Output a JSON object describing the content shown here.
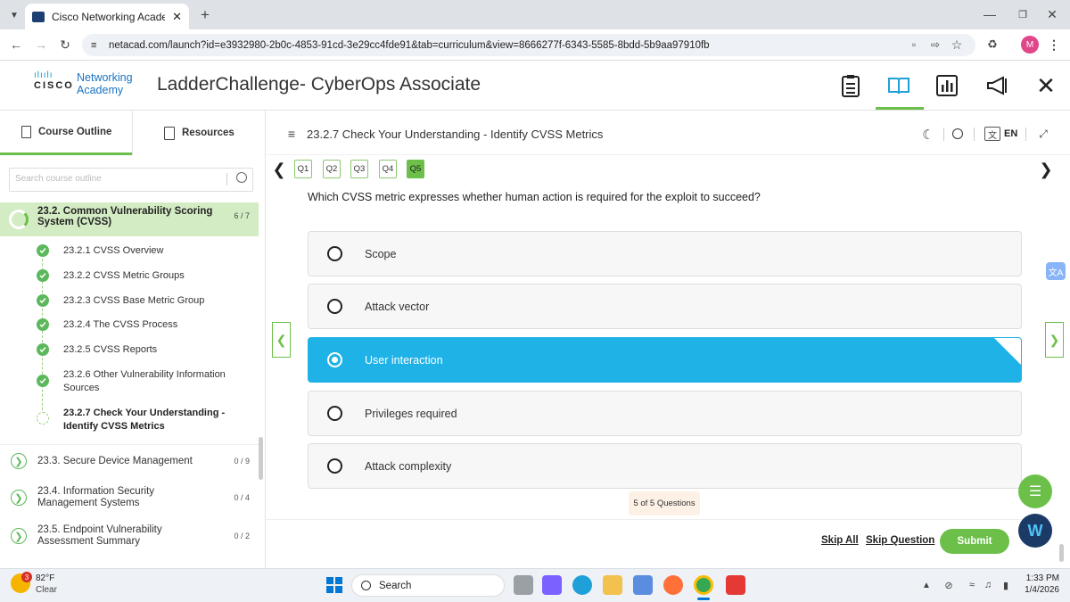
{
  "browser": {
    "tab_title": "Cisco Networking Academy: La",
    "url": "netacad.com/launch?id=e3932980-2b0c-4853-91cd-3e29cc4fde91&tab=curriculum&view=8666277f-6343-5585-8bdd-5b9aa97910fb",
    "profile_initial": "M"
  },
  "header": {
    "logo_networking": "Networking",
    "logo_academy": "Academy",
    "logo_cisco": "CISCO",
    "course_title": "LadderChallenge- CyberOps Associate"
  },
  "sidebar": {
    "tab_outline": "Course Outline",
    "tab_resources": "Resources",
    "search_placeholder": "Search course outline",
    "current_section": {
      "title": "23.2. Common Vulnerability Scoring System (CVSS)",
      "count": "6 / 7"
    },
    "subitems": [
      {
        "label": "23.2.1 CVSS Overview",
        "done": true
      },
      {
        "label": "23.2.2 CVSS Metric Groups",
        "done": true
      },
      {
        "label": "23.2.3 CVSS Base Metric Group",
        "done": true
      },
      {
        "label": "23.2.4 The CVSS Process",
        "done": true
      },
      {
        "label": "23.2.5 CVSS Reports",
        "done": true
      },
      {
        "label": "23.2.6 Other Vulnerability Information Sources",
        "done": true
      },
      {
        "label": "23.2.7 Check Your Understanding - Identify CVSS Metrics",
        "done": false
      }
    ],
    "sections": [
      {
        "label": "23.3. Secure Device Management",
        "count": "0 / 9"
      },
      {
        "label": "23.4. Information Security Management Systems",
        "count": "0 / 4"
      },
      {
        "label": "23.5. Endpoint Vulnerability Assessment Summary",
        "count": "0 / 2"
      }
    ]
  },
  "main": {
    "page_title": "23.2.7 Check Your Understanding - Identify CVSS Metrics",
    "lang": "EN",
    "question_tabs": [
      "Q1",
      "Q2",
      "Q3",
      "Q4",
      "Q5"
    ],
    "active_question": "Q5",
    "question": "Which CVSS metric expresses whether human action is required for the exploit to succeed?",
    "options": [
      "Scope",
      "Attack vector",
      "User interaction",
      "Privileges required",
      "Attack complexity"
    ],
    "selected_option": "User interaction",
    "counter": "5 of 5 Questions",
    "skip_all": "Skip All",
    "skip_question": "Skip Question",
    "submit": "Submit"
  },
  "taskbar": {
    "weather_temp": "82°F",
    "weather_desc": "Clear",
    "weather_badge": "3",
    "search_label": "Search",
    "time": "1:33 PM",
    "date": "1/4/2026"
  },
  "colors": {
    "accent_green": "#6cc04a",
    "selected_blue": "#1fb2e6",
    "cisco_blue": "#049fd9"
  }
}
